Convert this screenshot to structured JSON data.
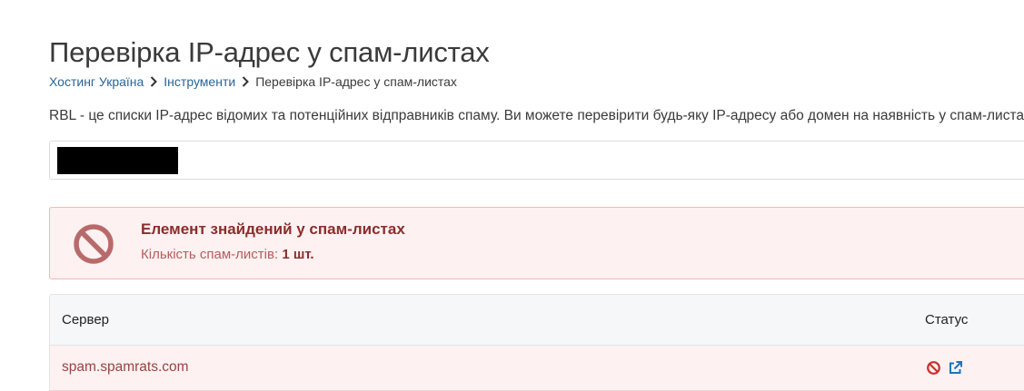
{
  "page": {
    "title": "Перевірка IP-адрес у спам-листах"
  },
  "breadcrumb": {
    "items": [
      {
        "label": "Хостинг Україна"
      },
      {
        "label": "Інструменти"
      },
      {
        "label": "Перевірка IP-адрес у спам-листах"
      }
    ],
    "separator_icon": "chevron-right-icon"
  },
  "intro": {
    "text": "RBL - це списки IP-адрес відомих та потенційних відправників спаму. Ви можете перевірити будь-яку IP-адресу або домен на наявність у спам-листах."
  },
  "search": {
    "value": "",
    "value_redacted": true
  },
  "alert": {
    "icon": "ban-icon",
    "title": "Елемент знайдений у спам-листах",
    "count_label": "Кількість спам-листів:",
    "count_value": "1 шт.",
    "colors": {
      "background": "#fdf1f1",
      "border": "#f2b8b8",
      "title": "#8b2d2d",
      "icon": "#b86a6a"
    }
  },
  "table": {
    "headers": {
      "server": "Сервер",
      "status": "Статус"
    },
    "rows": [
      {
        "server": "spam.spamrats.com",
        "status_icons": [
          "ban-icon",
          "external-link-icon"
        ]
      }
    ]
  },
  "colors": {
    "link": "#2a6496",
    "danger": "#c9302c",
    "info": "#1b75bb"
  }
}
